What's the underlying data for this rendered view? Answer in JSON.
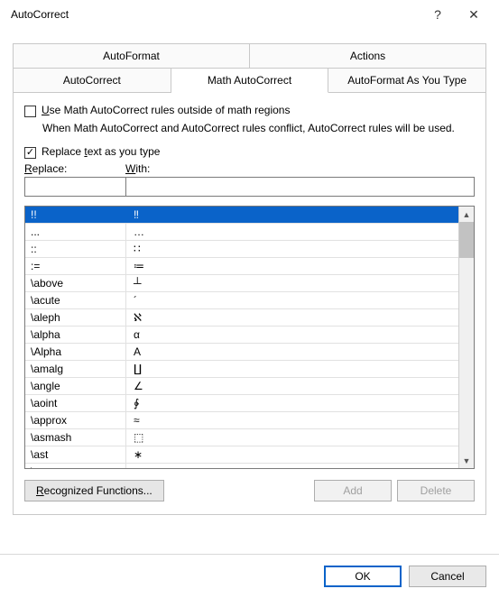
{
  "titlebar": {
    "title": "AutoCorrect",
    "help": "?",
    "close": "✕"
  },
  "tabs": {
    "upper": [
      {
        "label": "AutoFormat"
      },
      {
        "label": "Actions"
      }
    ],
    "lower": [
      {
        "label": "AutoCorrect"
      },
      {
        "label": "Math AutoCorrect",
        "active": true
      },
      {
        "label": "AutoFormat As You Type"
      }
    ]
  },
  "options": {
    "use_outside_label_pre": "U",
    "use_outside_label": "se Math AutoCorrect rules outside of math regions",
    "use_outside_checked": false,
    "conflict_note": "When Math AutoCorrect and AutoCorrect rules conflict, AutoCorrect rules will be used.",
    "replace_as_type_pre": "Replace ",
    "replace_as_type_accel": "t",
    "replace_as_type_post": "ext as you type",
    "replace_as_type_checked": true
  },
  "fields": {
    "replace_label_accel": "R",
    "replace_label_post": "eplace:",
    "with_label_accel": "W",
    "with_label_post": "ith:",
    "replace_value": "",
    "with_value": ""
  },
  "list": {
    "rows": [
      {
        "key": "!!",
        "val": "‼",
        "selected": true
      },
      {
        "key": "...",
        "val": "…"
      },
      {
        "key": "::",
        "val": "∷"
      },
      {
        "key": ":=",
        "val": "≔"
      },
      {
        "key": "\\above",
        "val": "┴"
      },
      {
        "key": "\\acute",
        "val": "´"
      },
      {
        "key": "\\aleph",
        "val": "ℵ"
      },
      {
        "key": "\\alpha",
        "val": "α"
      },
      {
        "key": "\\Alpha",
        "val": "Α"
      },
      {
        "key": "\\amalg",
        "val": "∐"
      },
      {
        "key": "\\angle",
        "val": "∠"
      },
      {
        "key": "\\aoint",
        "val": "∳"
      },
      {
        "key": "\\approx",
        "val": "≈"
      },
      {
        "key": "\\asmash",
        "val": "⬚"
      },
      {
        "key": "\\ast",
        "val": "∗"
      },
      {
        "key": "\\asymp",
        "val": "≍"
      }
    ]
  },
  "buttons": {
    "recognized": "Recognized Functions...",
    "add": "Add",
    "delete": "Delete",
    "ok": "OK",
    "cancel": "Cancel"
  }
}
